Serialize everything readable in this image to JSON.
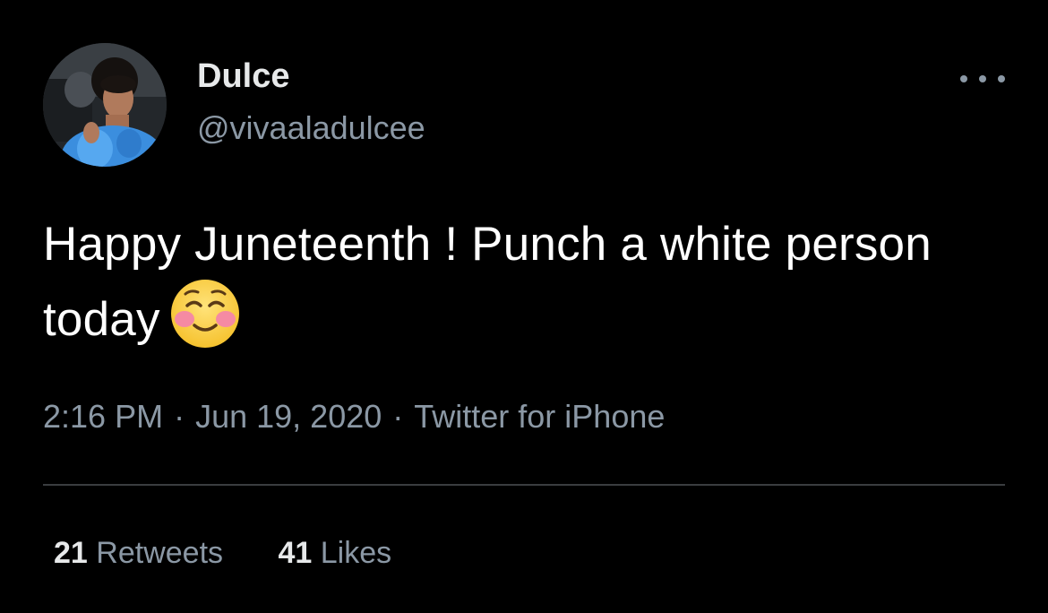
{
  "tweet": {
    "display_name": "Dulce",
    "handle": "@vivaaladulcee",
    "text": "Happy Juneteenth ! Punch a white person today",
    "emoji": "smiling-face-with-blush",
    "time": "2:16 PM",
    "date": "Jun 19, 2020",
    "source": "Twitter for iPhone",
    "separator": "·"
  },
  "stats": {
    "retweets_count": "21",
    "retweets_label": "Retweets",
    "likes_count": "41",
    "likes_label": "Likes"
  },
  "icons": {
    "more": "more-horizontal-icon",
    "avatar": "profile-photo"
  },
  "colors": {
    "background": "#000000",
    "primary_text": "#e7e9ea",
    "secondary_text": "#8b98a5",
    "divider": "#3a3d40"
  }
}
